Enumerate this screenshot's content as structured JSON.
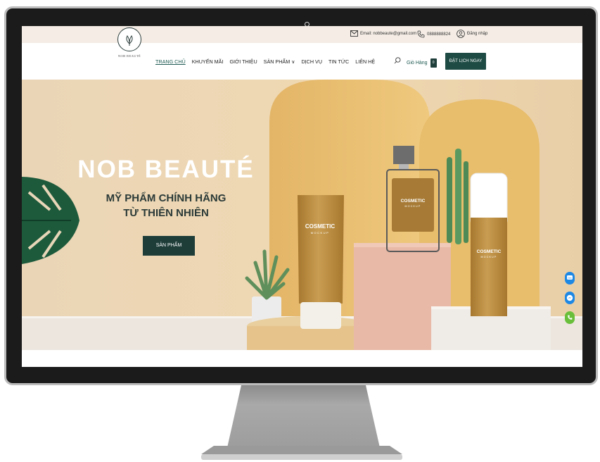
{
  "topbar": {
    "email": "Email: nobbeaute@gmail.com",
    "phone": "0888888824",
    "login": "Đăng nhập",
    "icons": {
      "email": "mail-icon",
      "phone": "phone-icon",
      "login": "user-icon"
    }
  },
  "logo": {
    "text": "NOB BEAUTÉ"
  },
  "menu": {
    "items": [
      {
        "label": "TRANG CHỦ",
        "active": true
      },
      {
        "label": "KHUYẾN MÃI"
      },
      {
        "label": "GIỚI THIỆU"
      },
      {
        "label": "SẢN PHẨM ∨"
      },
      {
        "label": "DỊCH VỤ"
      },
      {
        "label": "TIN TỨC"
      },
      {
        "label": "LIÊN HỆ"
      }
    ]
  },
  "cart": {
    "label": "Giỏ Hàng",
    "count": "0"
  },
  "book_button": "ĐẶT LỊCH NGAY",
  "hero": {
    "title": "NOB BEAUTÉ",
    "subtitle_line1": "MỸ PHẨM CHÍNH HÃNG",
    "subtitle_line2": "TỪ THIÊN NHIÊN",
    "button": "SẢN PHẨM",
    "product_labels": {
      "tube_brand": "COSMETIC",
      "tube_sub": "MOCKUP",
      "bottle_brand": "COSMETIC",
      "bottle_sub": "MOCKUP",
      "cylinder_brand": "COSMETIC",
      "cylinder_sub": "MOCKUP"
    }
  },
  "side_buttons": [
    "zalo-icon",
    "messenger-icon",
    "call-icon"
  ],
  "colors": {
    "brand_green": "#1e4b44",
    "topbar_bg": "#f4ece5",
    "hero_bg": "#ead5b4",
    "arch": "#e7bd72",
    "zalo": "#1e88e5",
    "messenger": "#1e88e5",
    "call": "#6abf3a"
  }
}
